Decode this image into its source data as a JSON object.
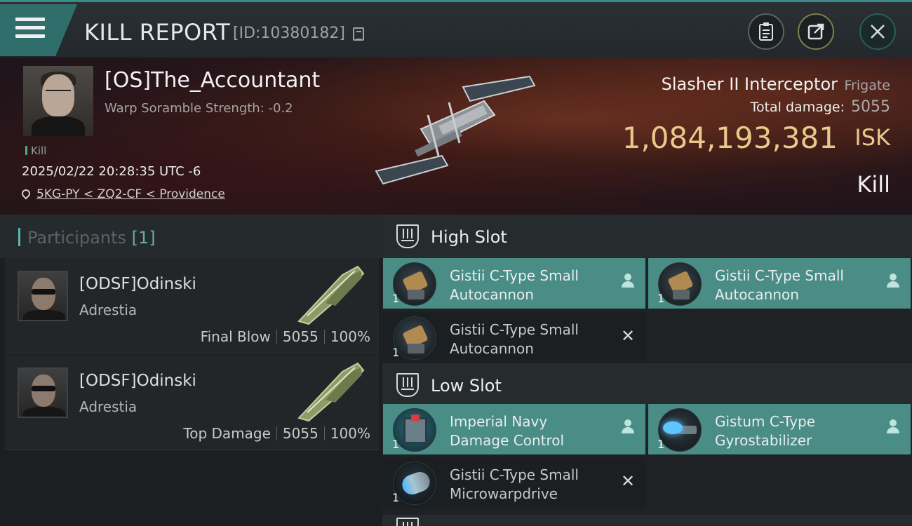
{
  "header": {
    "title": "KILL REPORT",
    "report_id": "[ID:10380182]"
  },
  "victim": {
    "name": "[OS]The_Accountant",
    "warp_scramble": "Warp Soramble Strength: -0.2",
    "tag": "Kill",
    "datetime": "2025/02/22 20:28:35 UTC -6",
    "location": "5KG-PY < ZQ2-CF < Providence"
  },
  "ship": {
    "name": "Slasher II Interceptor",
    "class": "Frigate",
    "total_damage_label": "Total damage:",
    "total_damage": "5055",
    "isk_value": "1,084,193,381",
    "isk_unit": "ISK",
    "status": "Kill"
  },
  "participants": {
    "title": "Participants",
    "count": "[1]",
    "rows": [
      {
        "name": "[ODSF]Odinski",
        "ship": "Adrestia",
        "role": "Final Blow",
        "damage": "5055",
        "percent": "100%"
      },
      {
        "name": "[ODSF]Odinski",
        "ship": "Adrestia",
        "role": "Top Damage",
        "damage": "5055",
        "percent": "100%"
      }
    ]
  },
  "fitting": {
    "high_slot": {
      "title": "High Slot",
      "modules": [
        {
          "line1": "Gistii C-Type Small",
          "line2": "Autocannon",
          "qty": "1",
          "state": "dropped",
          "icon": "autocannon-icon"
        },
        {
          "line1": "Gistii C-Type Small",
          "line2": "Autocannon",
          "qty": "1",
          "state": "dropped",
          "icon": "autocannon-icon"
        },
        {
          "line1": "Gistii C-Type Small",
          "line2": "Autocannon",
          "qty": "1",
          "state": "destroyed",
          "icon": "autocannon-icon"
        }
      ]
    },
    "low_slot": {
      "title": "Low Slot",
      "modules": [
        {
          "line1": "Imperial Navy",
          "line2": "Damage Control",
          "qty": "1",
          "state": "dropped",
          "icon": "damage-control-icon"
        },
        {
          "line1": "Gistum C-Type",
          "line2": "Gyrostabilizer",
          "qty": "1",
          "state": "dropped",
          "icon": "gyrostabilizer-icon"
        },
        {
          "line1": "Gistii C-Type Small",
          "line2": "Microwarpdrive",
          "qty": "1",
          "state": "destroyed",
          "icon": "microwarpdrive-icon"
        }
      ]
    }
  },
  "colors": {
    "accent": "#4a8c86",
    "isk": "#e9c98a",
    "banner": "#3c1c17"
  }
}
